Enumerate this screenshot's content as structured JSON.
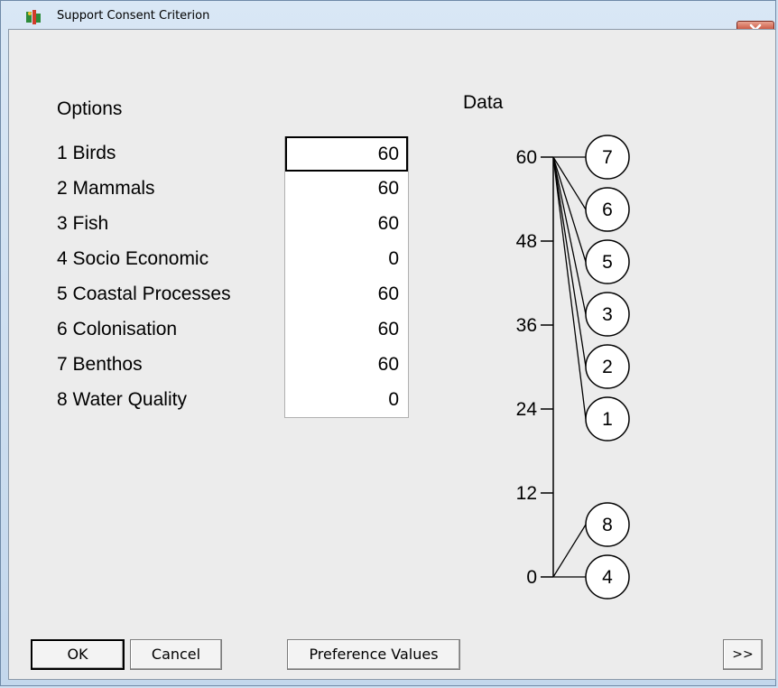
{
  "window": {
    "title": "Support Consent Criterion"
  },
  "options_heading": "Options",
  "data_heading": "Data",
  "options": [
    {
      "num": "1",
      "name": "Birds",
      "value": "60"
    },
    {
      "num": "2",
      "name": "Mammals",
      "value": "60"
    },
    {
      "num": "3",
      "name": "Fish",
      "value": "60"
    },
    {
      "num": "4",
      "name": "Socio Economic",
      "value": "0"
    },
    {
      "num": "5",
      "name": "Coastal Processes",
      "value": "60"
    },
    {
      "num": "6",
      "name": "Colonisation",
      "value": "60"
    },
    {
      "num": "7",
      "name": "Benthos",
      "value": "60"
    },
    {
      "num": "8",
      "name": "Water Quality",
      "value": "0"
    }
  ],
  "buttons": {
    "ok": "OK",
    "cancel": "Cancel",
    "preference": "Preference Values",
    "more": ">>"
  },
  "chart_data": {
    "type": "scatter",
    "title": "Data",
    "ylim": [
      0,
      60
    ],
    "ticks": [
      "0",
      "12",
      "24",
      "36",
      "48",
      "60"
    ],
    "tick_values": [
      0,
      12,
      24,
      36,
      48,
      60
    ],
    "markers_top_to_bottom": [
      "7",
      "6",
      "5",
      "3",
      "2",
      "1",
      "8",
      "4"
    ],
    "points": [
      {
        "label": "1",
        "value": 60
      },
      {
        "label": "2",
        "value": 60
      },
      {
        "label": "3",
        "value": 60
      },
      {
        "label": "4",
        "value": 0
      },
      {
        "label": "5",
        "value": 60
      },
      {
        "label": "6",
        "value": 60
      },
      {
        "label": "7",
        "value": 60
      },
      {
        "label": "8",
        "value": 0
      }
    ]
  }
}
